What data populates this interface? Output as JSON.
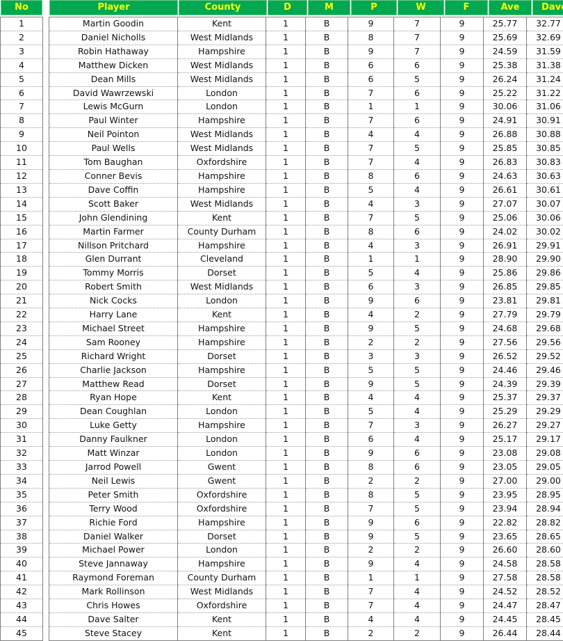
{
  "table": {
    "index_header": "No",
    "columns": [
      {
        "key": "player",
        "label": "Player"
      },
      {
        "key": "county",
        "label": "County"
      },
      {
        "key": "d",
        "label": "D"
      },
      {
        "key": "m",
        "label": "M"
      },
      {
        "key": "p",
        "label": "P"
      },
      {
        "key": "w",
        "label": "W"
      },
      {
        "key": "f",
        "label": "F"
      },
      {
        "key": "ave",
        "label": "Ave"
      },
      {
        "key": "dave",
        "label": "Dave"
      }
    ],
    "header_bg": "#00a94f",
    "header_text_color": "#ffff00",
    "row_count": 45,
    "rows": [
      {
        "no": "1",
        "player": "Martin Goodin",
        "county": "Kent",
        "d": "1",
        "m": "B",
        "p": "9",
        "w": "7",
        "f": "9",
        "ave": "25.77",
        "dave": "32.77"
      },
      {
        "no": "2",
        "player": "Daniel Nicholls",
        "county": "West Midlands",
        "d": "1",
        "m": "B",
        "p": "8",
        "w": "7",
        "f": "9",
        "ave": "25.69",
        "dave": "32.69"
      },
      {
        "no": "3",
        "player": "Robin Hathaway",
        "county": "Hampshire",
        "d": "1",
        "m": "B",
        "p": "9",
        "w": "7",
        "f": "9",
        "ave": "24.59",
        "dave": "31.59"
      },
      {
        "no": "4",
        "player": "Matthew Dicken",
        "county": "West Midlands",
        "d": "1",
        "m": "B",
        "p": "6",
        "w": "6",
        "f": "9",
        "ave": "25.38",
        "dave": "31.38"
      },
      {
        "no": "5",
        "player": "Dean Mills",
        "county": "West Midlands",
        "d": "1",
        "m": "B",
        "p": "6",
        "w": "5",
        "f": "9",
        "ave": "26.24",
        "dave": "31.24"
      },
      {
        "no": "6",
        "player": "David Wawrzewski",
        "county": "London",
        "d": "1",
        "m": "B",
        "p": "7",
        "w": "6",
        "f": "9",
        "ave": "25.22",
        "dave": "31.22"
      },
      {
        "no": "7",
        "player": "Lewis McGurn",
        "county": "London",
        "d": "1",
        "m": "B",
        "p": "1",
        "w": "1",
        "f": "9",
        "ave": "30.06",
        "dave": "31.06"
      },
      {
        "no": "8",
        "player": "Paul Winter",
        "county": "Hampshire",
        "d": "1",
        "m": "B",
        "p": "7",
        "w": "6",
        "f": "9",
        "ave": "24.91",
        "dave": "30.91"
      },
      {
        "no": "9",
        "player": "Neil Pointon",
        "county": "West Midlands",
        "d": "1",
        "m": "B",
        "p": "4",
        "w": "4",
        "f": "9",
        "ave": "26.88",
        "dave": "30.88"
      },
      {
        "no": "10",
        "player": "Paul Wells",
        "county": "West Midlands",
        "d": "1",
        "m": "B",
        "p": "7",
        "w": "5",
        "f": "9",
        "ave": "25.85",
        "dave": "30.85"
      },
      {
        "no": "11",
        "player": "Tom Baughan",
        "county": "Oxfordshire",
        "d": "1",
        "m": "B",
        "p": "7",
        "w": "4",
        "f": "9",
        "ave": "26.83",
        "dave": "30.83"
      },
      {
        "no": "12",
        "player": "Conner Bevis",
        "county": "Hampshire",
        "d": "1",
        "m": "B",
        "p": "8",
        "w": "6",
        "f": "9",
        "ave": "24.63",
        "dave": "30.63"
      },
      {
        "no": "13",
        "player": "Dave Coffin",
        "county": "Hampshire",
        "d": "1",
        "m": "B",
        "p": "5",
        "w": "4",
        "f": "9",
        "ave": "26.61",
        "dave": "30.61"
      },
      {
        "no": "14",
        "player": "Scott Baker",
        "county": "West Midlands",
        "d": "1",
        "m": "B",
        "p": "4",
        "w": "3",
        "f": "9",
        "ave": "27.07",
        "dave": "30.07"
      },
      {
        "no": "15",
        "player": "John Glendining",
        "county": "Kent",
        "d": "1",
        "m": "B",
        "p": "7",
        "w": "5",
        "f": "9",
        "ave": "25.06",
        "dave": "30.06"
      },
      {
        "no": "16",
        "player": "Martin Farmer",
        "county": "County Durham",
        "d": "1",
        "m": "B",
        "p": "8",
        "w": "6",
        "f": "9",
        "ave": "24.02",
        "dave": "30.02"
      },
      {
        "no": "17",
        "player": "Nillson Pritchard",
        "county": "Hampshire",
        "d": "1",
        "m": "B",
        "p": "4",
        "w": "3",
        "f": "9",
        "ave": "26.91",
        "dave": "29.91"
      },
      {
        "no": "18",
        "player": "Glen Durrant",
        "county": "Cleveland",
        "d": "1",
        "m": "B",
        "p": "1",
        "w": "1",
        "f": "9",
        "ave": "28.90",
        "dave": "29.90"
      },
      {
        "no": "19",
        "player": "Tommy Morris",
        "county": "Dorset",
        "d": "1",
        "m": "B",
        "p": "5",
        "w": "4",
        "f": "9",
        "ave": "25.86",
        "dave": "29.86"
      },
      {
        "no": "20",
        "player": "Robert Smith",
        "county": "West Midlands",
        "d": "1",
        "m": "B",
        "p": "6",
        "w": "3",
        "f": "9",
        "ave": "26.85",
        "dave": "29.85"
      },
      {
        "no": "21",
        "player": "Nick Cocks",
        "county": "London",
        "d": "1",
        "m": "B",
        "p": "9",
        "w": "6",
        "f": "9",
        "ave": "23.81",
        "dave": "29.81"
      },
      {
        "no": "22",
        "player": "Harry Lane",
        "county": "Kent",
        "d": "1",
        "m": "B",
        "p": "4",
        "w": "2",
        "f": "9",
        "ave": "27.79",
        "dave": "29.79"
      },
      {
        "no": "23",
        "player": "Michael Street",
        "county": "Hampshire",
        "d": "1",
        "m": "B",
        "p": "9",
        "w": "5",
        "f": "9",
        "ave": "24.68",
        "dave": "29.68"
      },
      {
        "no": "24",
        "player": "Sam Rooney",
        "county": "Hampshire",
        "d": "1",
        "m": "B",
        "p": "2",
        "w": "2",
        "f": "9",
        "ave": "27.56",
        "dave": "29.56"
      },
      {
        "no": "25",
        "player": "Richard Wright",
        "county": "Dorset",
        "d": "1",
        "m": "B",
        "p": "3",
        "w": "3",
        "f": "9",
        "ave": "26.52",
        "dave": "29.52"
      },
      {
        "no": "26",
        "player": "Charlie Jackson",
        "county": "Hampshire",
        "d": "1",
        "m": "B",
        "p": "5",
        "w": "5",
        "f": "9",
        "ave": "24.46",
        "dave": "29.46"
      },
      {
        "no": "27",
        "player": "Matthew Read",
        "county": "Dorset",
        "d": "1",
        "m": "B",
        "p": "9",
        "w": "5",
        "f": "9",
        "ave": "24.39",
        "dave": "29.39"
      },
      {
        "no": "28",
        "player": "Ryan Hope",
        "county": "Kent",
        "d": "1",
        "m": "B",
        "p": "4",
        "w": "4",
        "f": "9",
        "ave": "25.37",
        "dave": "29.37"
      },
      {
        "no": "29",
        "player": "Dean Coughlan",
        "county": "London",
        "d": "1",
        "m": "B",
        "p": "5",
        "w": "4",
        "f": "9",
        "ave": "25.29",
        "dave": "29.29"
      },
      {
        "no": "30",
        "player": "Luke Getty",
        "county": "Hampshire",
        "d": "1",
        "m": "B",
        "p": "7",
        "w": "3",
        "f": "9",
        "ave": "26.27",
        "dave": "29.27"
      },
      {
        "no": "31",
        "player": "Danny Faulkner",
        "county": "London",
        "d": "1",
        "m": "B",
        "p": "6",
        "w": "4",
        "f": "9",
        "ave": "25.17",
        "dave": "29.17"
      },
      {
        "no": "32",
        "player": "Matt Winzar",
        "county": "London",
        "d": "1",
        "m": "B",
        "p": "9",
        "w": "6",
        "f": "9",
        "ave": "23.08",
        "dave": "29.08"
      },
      {
        "no": "33",
        "player": "Jarrod Powell",
        "county": "Gwent",
        "d": "1",
        "m": "B",
        "p": "8",
        "w": "6",
        "f": "9",
        "ave": "23.05",
        "dave": "29.05"
      },
      {
        "no": "34",
        "player": "Neil Lewis",
        "county": "Gwent",
        "d": "1",
        "m": "B",
        "p": "2",
        "w": "2",
        "f": "9",
        "ave": "27.00",
        "dave": "29.00"
      },
      {
        "no": "35",
        "player": "Peter Smith",
        "county": "Oxfordshire",
        "d": "1",
        "m": "B",
        "p": "8",
        "w": "5",
        "f": "9",
        "ave": "23.95",
        "dave": "28.95"
      },
      {
        "no": "36",
        "player": "Terry Wood",
        "county": "Oxfordshire",
        "d": "1",
        "m": "B",
        "p": "7",
        "w": "5",
        "f": "9",
        "ave": "23.94",
        "dave": "28.94"
      },
      {
        "no": "37",
        "player": "Richie Ford",
        "county": "Hampshire",
        "d": "1",
        "m": "B",
        "p": "9",
        "w": "6",
        "f": "9",
        "ave": "22.82",
        "dave": "28.82"
      },
      {
        "no": "38",
        "player": "Daniel Walker",
        "county": "Dorset",
        "d": "1",
        "m": "B",
        "p": "9",
        "w": "5",
        "f": "9",
        "ave": "23.65",
        "dave": "28.65"
      },
      {
        "no": "39",
        "player": "Michael Power",
        "county": "London",
        "d": "1",
        "m": "B",
        "p": "2",
        "w": "2",
        "f": "9",
        "ave": "26.60",
        "dave": "28.60"
      },
      {
        "no": "40",
        "player": "Steve Jannaway",
        "county": "Hampshire",
        "d": "1",
        "m": "B",
        "p": "9",
        "w": "4",
        "f": "9",
        "ave": "24.58",
        "dave": "28.58"
      },
      {
        "no": "41",
        "player": "Raymond Foreman",
        "county": "County Durham",
        "d": "1",
        "m": "B",
        "p": "1",
        "w": "1",
        "f": "9",
        "ave": "27.58",
        "dave": "28.58"
      },
      {
        "no": "42",
        "player": "Mark Rollinson",
        "county": "West Midlands",
        "d": "1",
        "m": "B",
        "p": "7",
        "w": "4",
        "f": "9",
        "ave": "24.52",
        "dave": "28.52"
      },
      {
        "no": "43",
        "player": "Chris Howes",
        "county": "Oxfordshire",
        "d": "1",
        "m": "B",
        "p": "7",
        "w": "4",
        "f": "9",
        "ave": "24.47",
        "dave": "28.47"
      },
      {
        "no": "44",
        "player": "Dave Salter",
        "county": "Kent",
        "d": "1",
        "m": "B",
        "p": "4",
        "w": "4",
        "f": "9",
        "ave": "24.45",
        "dave": "28.45"
      },
      {
        "no": "45",
        "player": "Steve Stacey",
        "county": "Kent",
        "d": "1",
        "m": "B",
        "p": "2",
        "w": "2",
        "f": "9",
        "ave": "26.44",
        "dave": "28.44"
      }
    ]
  }
}
